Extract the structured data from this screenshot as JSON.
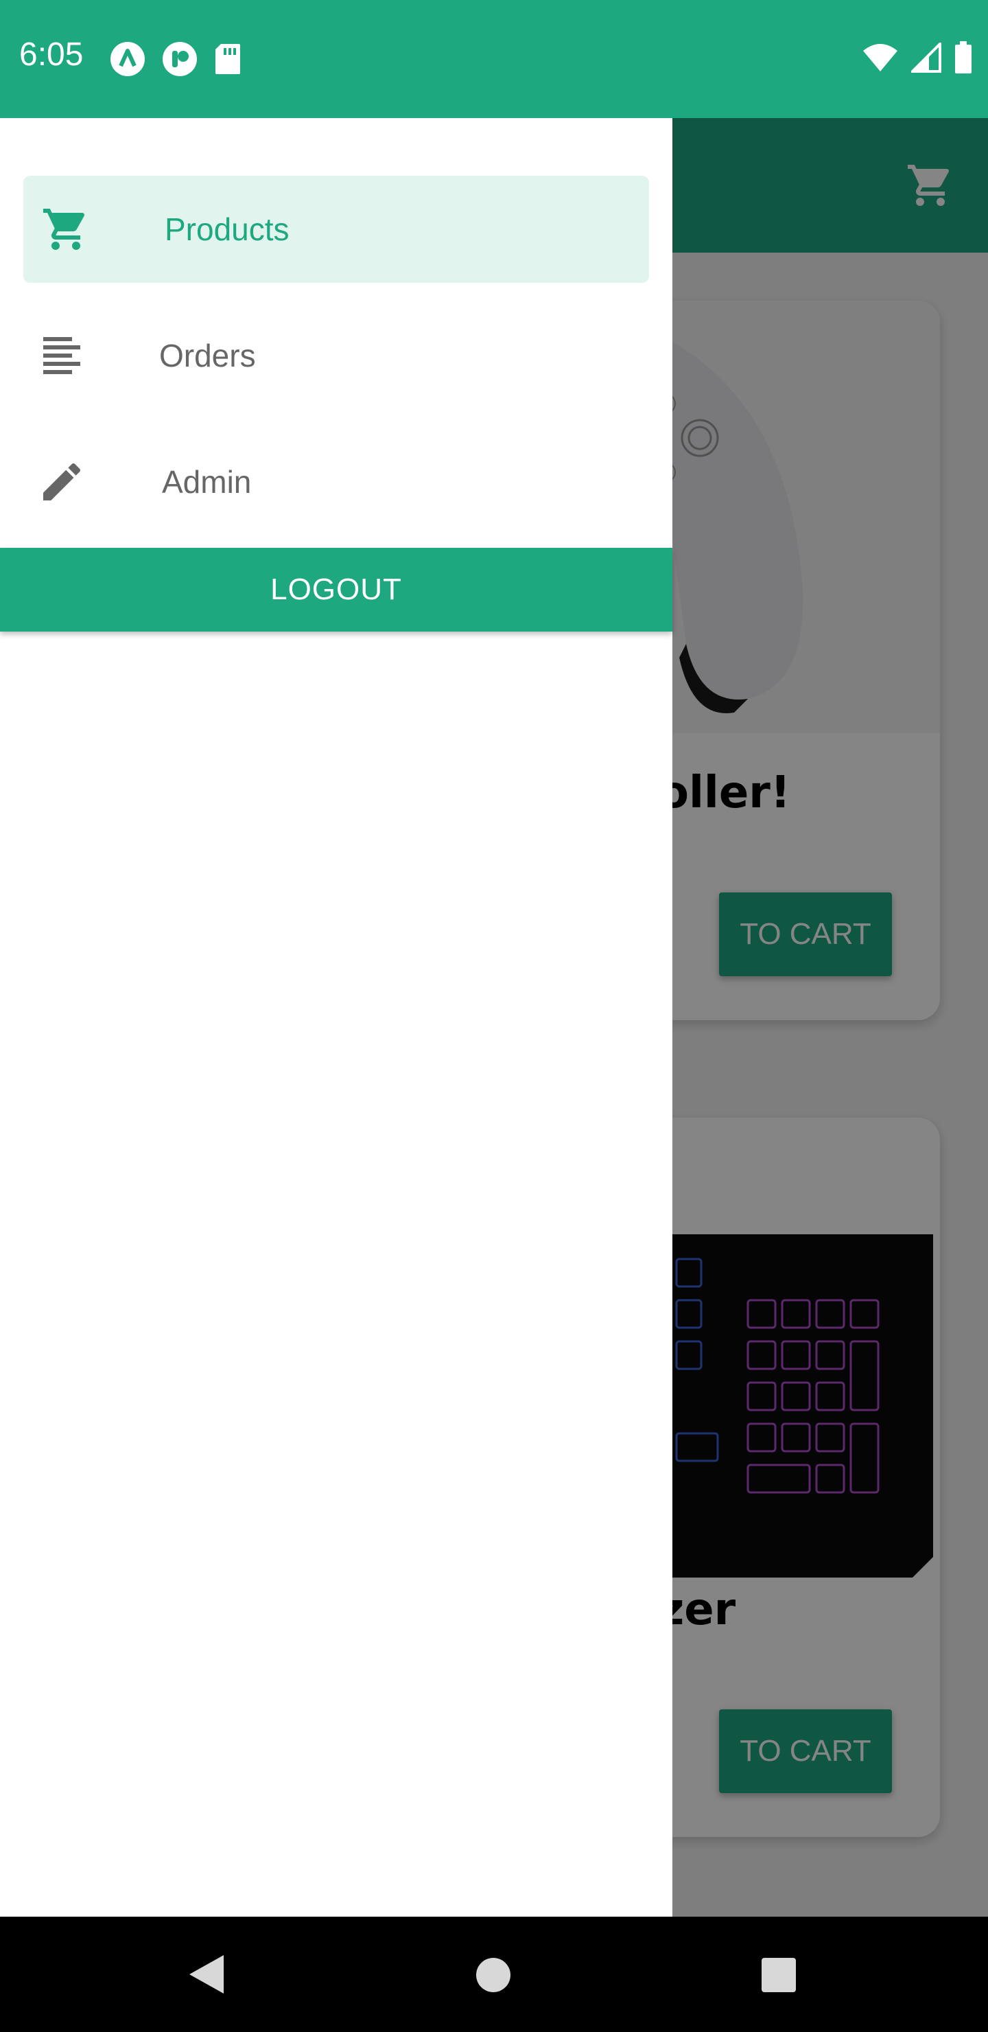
{
  "status_bar": {
    "time": "6:05",
    "left_icons": [
      "app-a-icon",
      "app-p-icon",
      "sd-card-icon"
    ],
    "right_icons": [
      "wifi-icon",
      "cell-signal-icon",
      "battery-icon"
    ],
    "color": "#1ea880"
  },
  "drawer": {
    "items": [
      {
        "label": "Products",
        "icon": "cart-icon",
        "active": true
      },
      {
        "label": "Orders",
        "icon": "list-icon",
        "active": false
      },
      {
        "label": "Admin",
        "icon": "pencil-icon",
        "active": false
      }
    ],
    "logout_label": "LOGOUT"
  },
  "background_screen": {
    "appbar": {
      "cart_icon": "cart-icon"
    },
    "products": [
      {
        "title_visible": "oller!",
        "button": "TO CART"
      },
      {
        "title_visible": "zer",
        "button": "TO CART"
      }
    ]
  },
  "nav_bar": {
    "buttons": [
      "back-icon",
      "home-icon",
      "recents-icon"
    ]
  },
  "colors": {
    "accent": "#1ea880",
    "active_bg": "#e2f4ee",
    "text_muted": "#666666"
  }
}
